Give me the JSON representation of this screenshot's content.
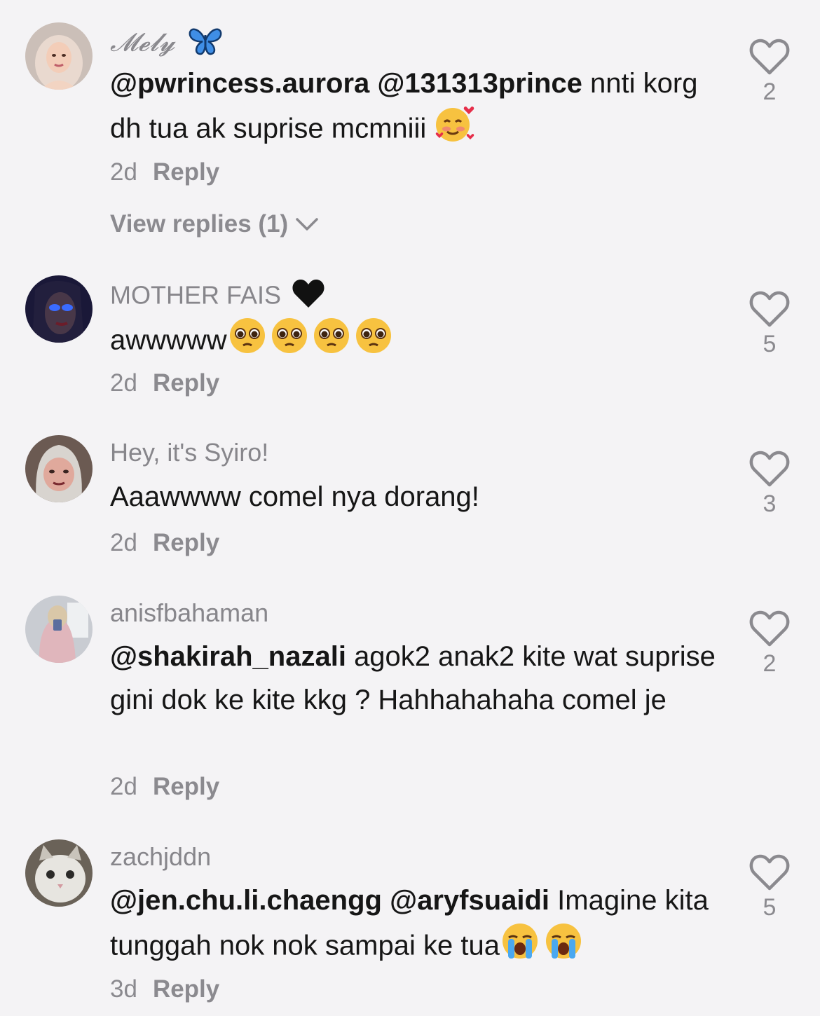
{
  "comments": [
    {
      "username": "𝓜𝓮𝓵𝔂",
      "username_icon": "butterfly-icon",
      "mentions": [
        "@pwrincess.aurora",
        "@131313prince"
      ],
      "text": "nnti korg dh tua ak suprise mcmniii",
      "emojis": [
        "smiling-face-with-hearts-icon"
      ],
      "time": "2d",
      "reply_label": "Reply",
      "view_replies": "View replies (1)",
      "likes": "2"
    },
    {
      "username": "MOTHER FAIS",
      "username_icon": "black-heart-icon",
      "mentions": [],
      "text": "awwwww",
      "emojis": [
        "pleading-face-icon",
        "pleading-face-icon",
        "pleading-face-icon",
        "pleading-face-icon"
      ],
      "time": "2d",
      "reply_label": "Reply",
      "likes": "5"
    },
    {
      "username": "Hey, it's Syiro!",
      "mentions": [],
      "text": "Aaawwww comel nya dorang!",
      "time": "2d",
      "reply_label": "Reply",
      "likes": "3"
    },
    {
      "username": "anisfbahaman",
      "mentions": [
        "@shakirah_nazali"
      ],
      "text": "agok2 anak2 kite wat suprise gini dok ke kite kkg ? Hahhahahaha comel je",
      "time": "2d",
      "reply_label": "Reply",
      "likes": "2"
    },
    {
      "username": "zachjddn",
      "mentions": [
        "@jen.chu.li.chaengg",
        "@aryfsuaidi"
      ],
      "text": "Imagine kita tunggah nok nok sampai ke tua",
      "emojis": [
        "loudly-crying-face-icon",
        "loudly-crying-face-icon"
      ],
      "time": "3d",
      "reply_label": "Reply",
      "likes": "5"
    }
  ]
}
